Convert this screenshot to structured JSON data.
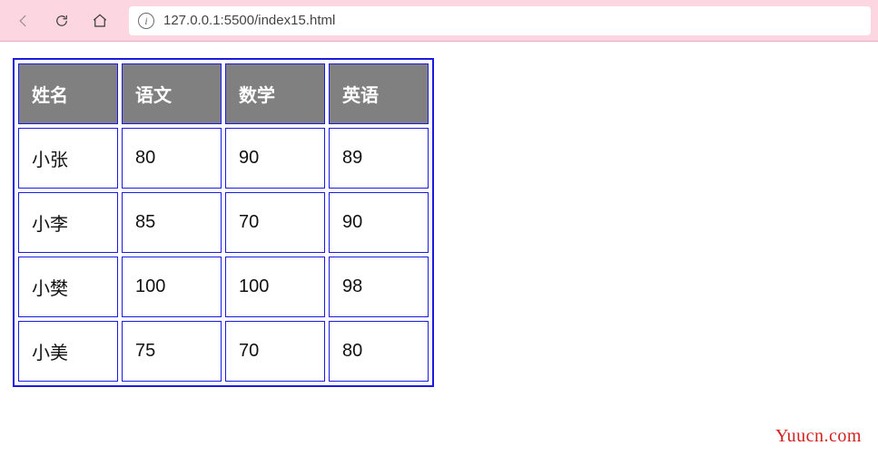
{
  "browser": {
    "url": "127.0.0.1:5500/index15.html"
  },
  "table": {
    "headers": [
      "姓名",
      "语文",
      "数学",
      "英语"
    ],
    "rows": [
      {
        "name": "小张",
        "c1": "80",
        "c2": "90",
        "c3": "89"
      },
      {
        "name": "小李",
        "c1": "85",
        "c2": "70",
        "c3": "90"
      },
      {
        "name": "小樊",
        "c1": "100",
        "c2": "100",
        "c3": "98"
      },
      {
        "name": "小美",
        "c1": "75",
        "c2": "70",
        "c3": "80"
      }
    ]
  },
  "watermark": "Yuucn.com",
  "chart_data": {
    "type": "table",
    "title": "",
    "columns": [
      "姓名",
      "语文",
      "数学",
      "英语"
    ],
    "rows": [
      [
        "小张",
        80,
        90,
        89
      ],
      [
        "小李",
        85,
        70,
        90
      ],
      [
        "小樊",
        100,
        100,
        98
      ],
      [
        "小美",
        75,
        70,
        80
      ]
    ]
  }
}
